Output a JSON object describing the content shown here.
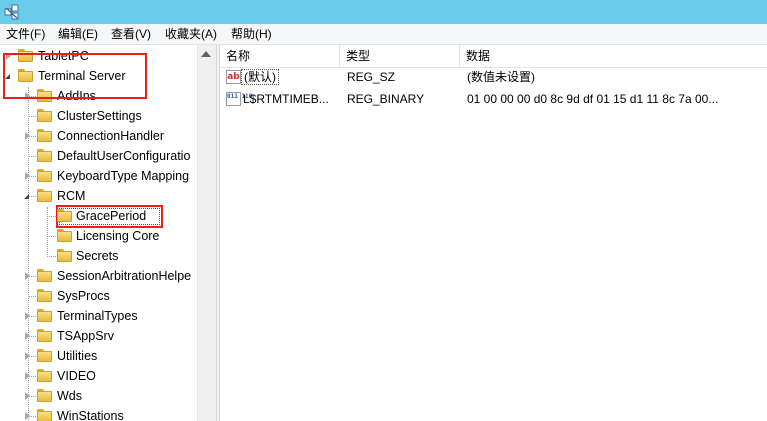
{
  "menu": {
    "items": [
      {
        "label": "文件(F)"
      },
      {
        "label": "编辑(E)"
      },
      {
        "label": "查看(V)"
      },
      {
        "label": "收藏夹(A)"
      },
      {
        "label": "帮助(H)"
      }
    ]
  },
  "tree": {
    "items": [
      {
        "label": "TabletPC",
        "state": "collapsed"
      },
      {
        "label": "Terminal Server",
        "state": "expanded"
      },
      {
        "label": "AddIns",
        "state": "collapsed"
      },
      {
        "label": "ClusterSettings",
        "state": "none"
      },
      {
        "label": "ConnectionHandler",
        "state": "collapsed"
      },
      {
        "label": "DefaultUserConfiguratio",
        "state": "none"
      },
      {
        "label": "KeyboardType Mapping",
        "state": "collapsed"
      },
      {
        "label": "RCM",
        "state": "expanded"
      },
      {
        "label": "GracePeriod",
        "state": "none",
        "selected": true
      },
      {
        "label": "Licensing Core",
        "state": "none"
      },
      {
        "label": "Secrets",
        "state": "none"
      },
      {
        "label": "SessionArbitrationHelpe",
        "state": "collapsed"
      },
      {
        "label": "SysProcs",
        "state": "none"
      },
      {
        "label": "TerminalTypes",
        "state": "collapsed"
      },
      {
        "label": "TSAppSrv",
        "state": "collapsed"
      },
      {
        "label": "Utilities",
        "state": "collapsed"
      },
      {
        "label": "VIDEO",
        "state": "collapsed"
      },
      {
        "label": "Wds",
        "state": "collapsed"
      },
      {
        "label": "WinStations",
        "state": "collapsed"
      }
    ]
  },
  "list": {
    "columns": [
      "名称",
      "类型",
      "数据"
    ],
    "rows": [
      {
        "icon": "string-value-icon",
        "name": "(默认)",
        "type": "REG_SZ",
        "data": "(数值未设置)"
      },
      {
        "icon": "binary-value-icon",
        "name": "L$RTMTIMEB...",
        "type": "REG_BINARY",
        "data": "01 00 00 00 d0 8c 9d df 01 15 d1 11 8c 7a 00..."
      }
    ]
  },
  "icons": {
    "string_value_glyph": "ab",
    "binary_value_glyph": "011 110"
  },
  "colors": {
    "titlebar": "#6bcbea",
    "highlight_box": "#e8201c",
    "folder": "#e9bb3c"
  }
}
